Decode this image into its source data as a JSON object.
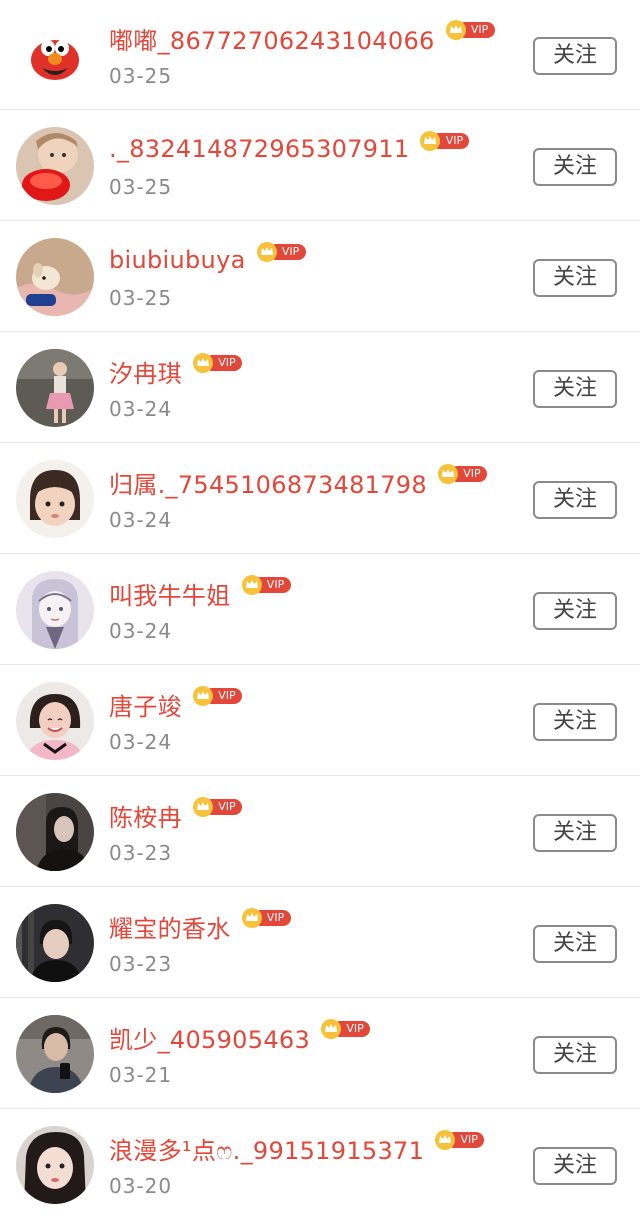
{
  "users": [
    {
      "name": "嘟嘟_86772706243104066",
      "date": "03-25",
      "vip": "VIP",
      "follow": "关注",
      "avatar": "elmo-avatar"
    },
    {
      "name": "._832414872965307911",
      "date": "03-25",
      "vip": "VIP",
      "follow": "关注",
      "avatar": "baby-with-red-bowl-avatar"
    },
    {
      "name": "biubiubuya",
      "date": "03-25",
      "vip": "VIP",
      "follow": "关注",
      "avatar": "dog-on-blanket-avatar"
    },
    {
      "name": "汐冉琪",
      "date": "03-24",
      "vip": "VIP",
      "follow": "关注",
      "avatar": "girl-pink-skirt-avatar"
    },
    {
      "name": "归属._7545106873481798",
      "date": "03-24",
      "vip": "VIP",
      "follow": "关注",
      "avatar": "toddler-girl-avatar"
    },
    {
      "name": "叫我牛牛姐",
      "date": "03-24",
      "vip": "VIP",
      "follow": "关注",
      "avatar": "anime-sketch-girl-avatar"
    },
    {
      "name": "唐子竣",
      "date": "03-24",
      "vip": "VIP",
      "follow": "关注",
      "avatar": "smiling-girl-avatar"
    },
    {
      "name": "陈桉冉",
      "date": "03-23",
      "vip": "VIP",
      "follow": "关注",
      "avatar": "dark-portrait-avatar"
    },
    {
      "name": "耀宝的香水",
      "date": "03-23",
      "vip": "VIP",
      "follow": "关注",
      "avatar": "young-man-avatar"
    },
    {
      "name": "凯少_405905463",
      "date": "03-21",
      "vip": "VIP",
      "follow": "关注",
      "avatar": "man-with-phone-avatar"
    },
    {
      "name": "浪漫多¹点ෆ._99151915371",
      "date": "03-20",
      "vip": "VIP",
      "follow": "关注",
      "avatar": "girl-portrait-avatar"
    }
  ],
  "colors": {
    "name": "#e2473a",
    "date": "#8a8a8a",
    "vip_pill": "#e2473a",
    "vip_coin": "#f6c23a",
    "follow_border": "#8a8a8a",
    "divider": "#e9e9e9"
  }
}
